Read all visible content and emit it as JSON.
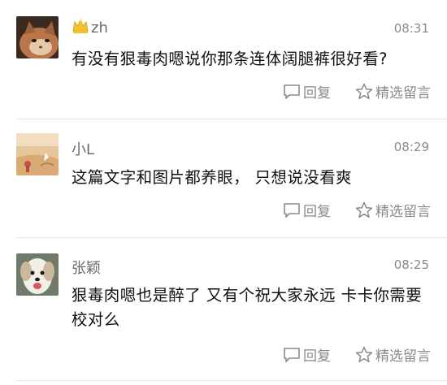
{
  "colors": {
    "name": "#6b6b6b",
    "time": "#8a8a8a",
    "text": "#111111",
    "action": "#8a8a8a",
    "divider": "#e4e4e4",
    "crown": "#f2c230"
  },
  "comments": [
    {
      "name": "zh",
      "name_icon": "crown-icon",
      "time": "08:31",
      "text": "有没有狠毒肉嗯说你那条连体阔腿裤很好看?",
      "reply_label": "回复",
      "feature_label": "精选留言",
      "avatar_icon": "cat-avatar"
    },
    {
      "name": "小L",
      "time": "08:29",
      "text": "这篇文字和图片都养眼， 只想说没看爽",
      "reply_label": "回复",
      "feature_label": "精选留言",
      "avatar_icon": "beach-avatar"
    },
    {
      "name": "张颖",
      "time": "08:25",
      "text": "狠毒肉嗯也是醉了 又有个祝大家永远 卡卡你需要校对么",
      "reply_label": "回复",
      "feature_label": "精选留言",
      "avatar_icon": "dog-avatar"
    }
  ]
}
